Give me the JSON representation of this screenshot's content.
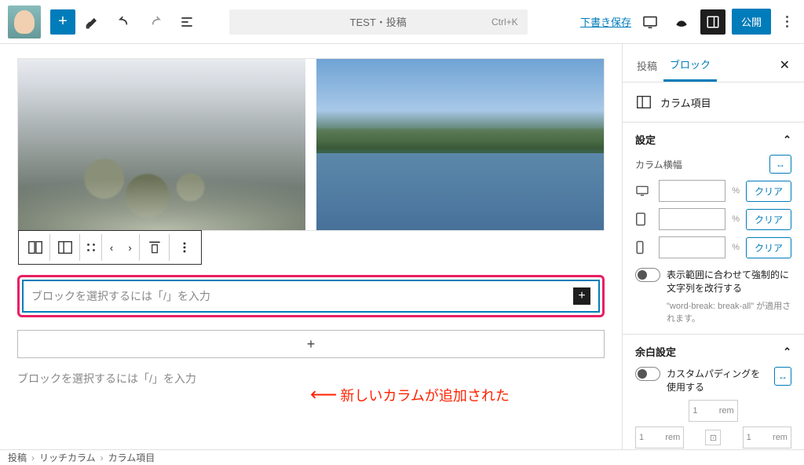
{
  "topbar": {
    "title": "TEST・投稿",
    "kbd_hint": "Ctrl+K",
    "save_draft": "下書き保存",
    "publish": "公開"
  },
  "block_toolbar": {
    "columns_icon": "columns-icon",
    "column_icon": "column-icon",
    "drag_icon": "drag-icon",
    "prev": "‹",
    "next": "›",
    "align_icon": "align-top-icon",
    "more_icon": "more-icon"
  },
  "new_column": {
    "placeholder": "ブロックを選択するには「/」を入力"
  },
  "annotation_text": "新しいカラムが追加された",
  "lower_placeholder": "ブロックを選択するには「/」を入力",
  "breadcrumb": {
    "post": "投稿",
    "rich": "リッチカラム",
    "item": "カラム項目"
  },
  "sidebar": {
    "tab_post": "投稿",
    "tab_block": "ブロック",
    "block_name": "カラム項目",
    "settings_label": "設定",
    "width_label": "カラム横幅",
    "unit_label": "%",
    "clear_label": "クリア",
    "wrap_toggle_label": "表示範囲に合わせて強制的に文字列を改行する",
    "wrap_help": "\"word-break: break-all\" が適用されます。",
    "margin_label": "余白設定",
    "custom_padding_label": "カスタムパディングを使用する",
    "pad_value": "1",
    "pad_unit": "rem"
  }
}
